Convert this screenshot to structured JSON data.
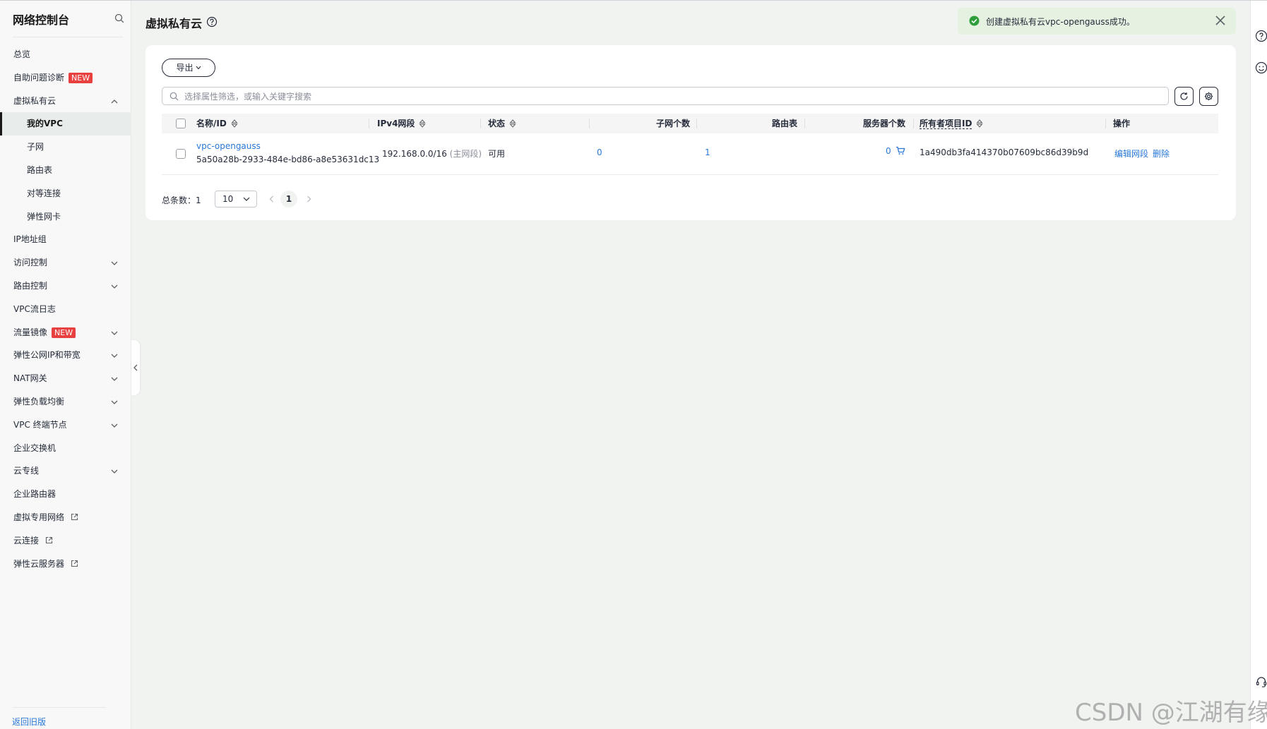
{
  "sidebar": {
    "title": "网络控制台",
    "items": [
      {
        "label": "总览"
      },
      {
        "label": "自助问题诊断",
        "badge": "NEW"
      },
      {
        "label": "虚拟私有云"
      },
      {
        "label": "我的VPC"
      },
      {
        "label": "子网"
      },
      {
        "label": "路由表"
      },
      {
        "label": "对等连接"
      },
      {
        "label": "弹性网卡"
      },
      {
        "label": "IP地址组"
      },
      {
        "label": "访问控制"
      },
      {
        "label": "路由控制"
      },
      {
        "label": "VPC流日志"
      },
      {
        "label": "流量镜像",
        "badge": "NEW"
      },
      {
        "label": "弹性公网IP和带宽"
      },
      {
        "label": "NAT网关"
      },
      {
        "label": "弹性负载均衡"
      },
      {
        "label": "VPC 终端节点"
      },
      {
        "label": "企业交换机"
      },
      {
        "label": "云专线"
      },
      {
        "label": "企业路由器"
      },
      {
        "label": "虚拟专用网络"
      },
      {
        "label": "云连接"
      },
      {
        "label": "弹性云服务器"
      }
    ],
    "back_link": "返回旧版"
  },
  "page": {
    "title": "虚拟私有云"
  },
  "toolbar": {
    "export_label": "导出",
    "search_placeholder": "选择属性筛选，或输入关键字搜索"
  },
  "table": {
    "headers": {
      "name": "名称/ID",
      "ipv4": "IPv4网段",
      "status": "状态",
      "subnets": "子网个数",
      "route_tables": "路由表",
      "servers": "服务器个数",
      "owner": "所有者项目ID",
      "actions": "操作"
    },
    "rows": [
      {
        "name": "vpc-opengauss",
        "id": "5a50a28b-2933-484e-bd86-a8e53631dc13",
        "ipv4": "192.168.0.0/16",
        "ipv4_note": "(主网段)",
        "status": "可用",
        "subnets": "0",
        "route_tables": "1",
        "servers": "0",
        "owner": "1a490db3fa414370b07609bc86d39b9d",
        "action_edit": "编辑网段",
        "action_delete": "删除"
      }
    ]
  },
  "pagination": {
    "total": "总条数：1",
    "page_size": "10",
    "current_page": "1"
  },
  "toast": {
    "message": "创建虚拟私有云vpc-opengauss成功。"
  },
  "watermark": "CSDN @江湖有缘",
  "colors": {
    "link": "#2878d8",
    "badge": "#e8403e",
    "success": "#2e9e3b",
    "toast_bg": "#e5f2e1"
  }
}
